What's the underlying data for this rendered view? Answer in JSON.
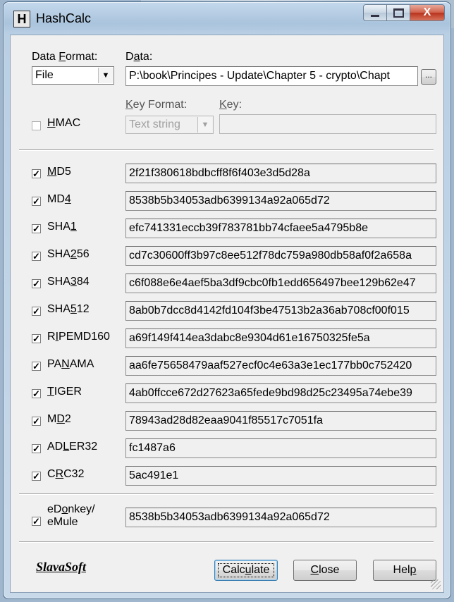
{
  "window": {
    "title": "HashCalc",
    "icon_letter": "H"
  },
  "titlebar_buttons": {
    "minimize": "minimize",
    "maximize": "maximize",
    "close": "X"
  },
  "data_format": {
    "label_pre": "Data ",
    "label_u": "F",
    "label_post": "ormat:",
    "value": "File"
  },
  "data": {
    "label_pre": "D",
    "label_u": "a",
    "label_post": "ta:",
    "value": "P:\\book\\Principes - Update\\Chapter 5 - crypto\\Chapt",
    "browse_label": "..."
  },
  "hmac": {
    "label_u": "H",
    "label_post": "MAC",
    "checked": false
  },
  "key_format": {
    "label_pre": "",
    "label_u": "K",
    "label_post": "ey Format:",
    "value": "Text string"
  },
  "key": {
    "label_u": "K",
    "label_post": "ey:",
    "value": ""
  },
  "hashes": [
    {
      "pre": "",
      "u": "M",
      "post": "D5",
      "value": "2f21f380618bdbcff8f6f403e3d5d28a"
    },
    {
      "pre": "MD",
      "u": "4",
      "post": "",
      "value": "8538b5b34053adb6399134a92a065d72"
    },
    {
      "pre": "SHA",
      "u": "1",
      "post": "",
      "value": "efc741331eccb39f783781bb74cfaee5a4795b8e"
    },
    {
      "pre": "SHA",
      "u": "2",
      "post": "56",
      "value": "cd7c30600ff3b97c8ee512f78dc759a980db58af0f2a658a"
    },
    {
      "pre": "SHA",
      "u": "3",
      "post": "84",
      "value": "c6f088e6e4aef5ba3df9cbc0fb1edd656497bee129b62e47"
    },
    {
      "pre": "SHA",
      "u": "5",
      "post": "12",
      "value": "8ab0b7dcc8d4142fd104f3be47513b2a36ab708cf00f015"
    },
    {
      "pre": "R",
      "u": "I",
      "post": "PEMD160",
      "value": "a69f149f414ea3dabc8e9304d61e16750325fe5a"
    },
    {
      "pre": "PA",
      "u": "N",
      "post": "AMA",
      "value": "aa6fe75658479aaf527ecf0c4e63a3e1ec177bb0c752420"
    },
    {
      "pre": "",
      "u": "T",
      "post": "IGER",
      "value": "4ab0ffcce672d27623a65fede9bd98d25c23495a74ebe39"
    },
    {
      "pre": "M",
      "u": "D",
      "post": "2",
      "value": "78943ad28d82eaa9041f85517c7051fa"
    },
    {
      "pre": "AD",
      "u": "L",
      "post": "ER32",
      "value": "fc1487a6"
    },
    {
      "pre": "C",
      "u": "R",
      "post": "C32",
      "value": "5ac491e1"
    }
  ],
  "edonkey": {
    "line1_pre": "eD",
    "line1_u": "o",
    "line1_post": "nkey/",
    "line2": "eMule",
    "value": "8538b5b34053adb6399134a92a065d72"
  },
  "footer": {
    "logo": "SlavaSoft",
    "calculate": {
      "pre": "Calc",
      "u": "u",
      "post": "late"
    },
    "close": {
      "pre": "",
      "u": "C",
      "post": "lose"
    },
    "help": {
      "pre": "Hel",
      "u": "p",
      "post": ""
    }
  }
}
